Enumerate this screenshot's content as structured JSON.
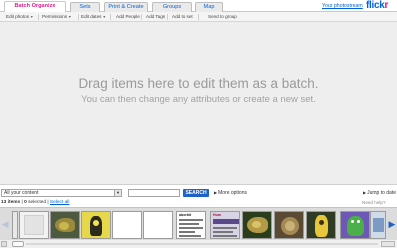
{
  "tabs": [
    {
      "label": "Batch Organize",
      "active": true
    },
    {
      "label": "Sets"
    },
    {
      "label": "Print & Create"
    },
    {
      "label": "Groups"
    },
    {
      "label": "Map"
    }
  ],
  "header": {
    "your_photostream": "Your photostream",
    "logo_left": "flick",
    "logo_right": "r"
  },
  "toolbar": {
    "edit_photos": "Edit photos",
    "permissions": "Permissions",
    "edit_dates": "Edit dates",
    "add_people": "Add People",
    "add_tags": "Add Tags",
    "add_to_set": "Add to set",
    "send_to_group": "Send to group",
    "dropdown_arrow": "▼"
  },
  "drop_area": {
    "main_text": "Drag items here to edit them as a batch.",
    "sub_text": "You can then change any attributes or create a new set."
  },
  "filter": {
    "content_select": "All your content",
    "search_placeholder": "",
    "search_button": "SEARCH",
    "more_options": "More options",
    "jump_to_date": "Jump to date"
  },
  "strip_header": {
    "count_prefix": "13 items",
    "count_sep": " | ",
    "selected_count": "0",
    "selected_label": " selected | ",
    "select_all": "Select all",
    "need_help": "Need help?"
  },
  "thumb_doc": {
    "title_a": "aborbit",
    "title_b": "Hum"
  },
  "icons": {
    "nav_left": "◀",
    "nav_right": "▶",
    "triangle_right": "▶"
  },
  "colors": {
    "accent_pink": "#ff0084",
    "flickr_blue": "#0063dc",
    "search_button": "#1f62c6",
    "drop_area_bg": "#eeeeee"
  }
}
